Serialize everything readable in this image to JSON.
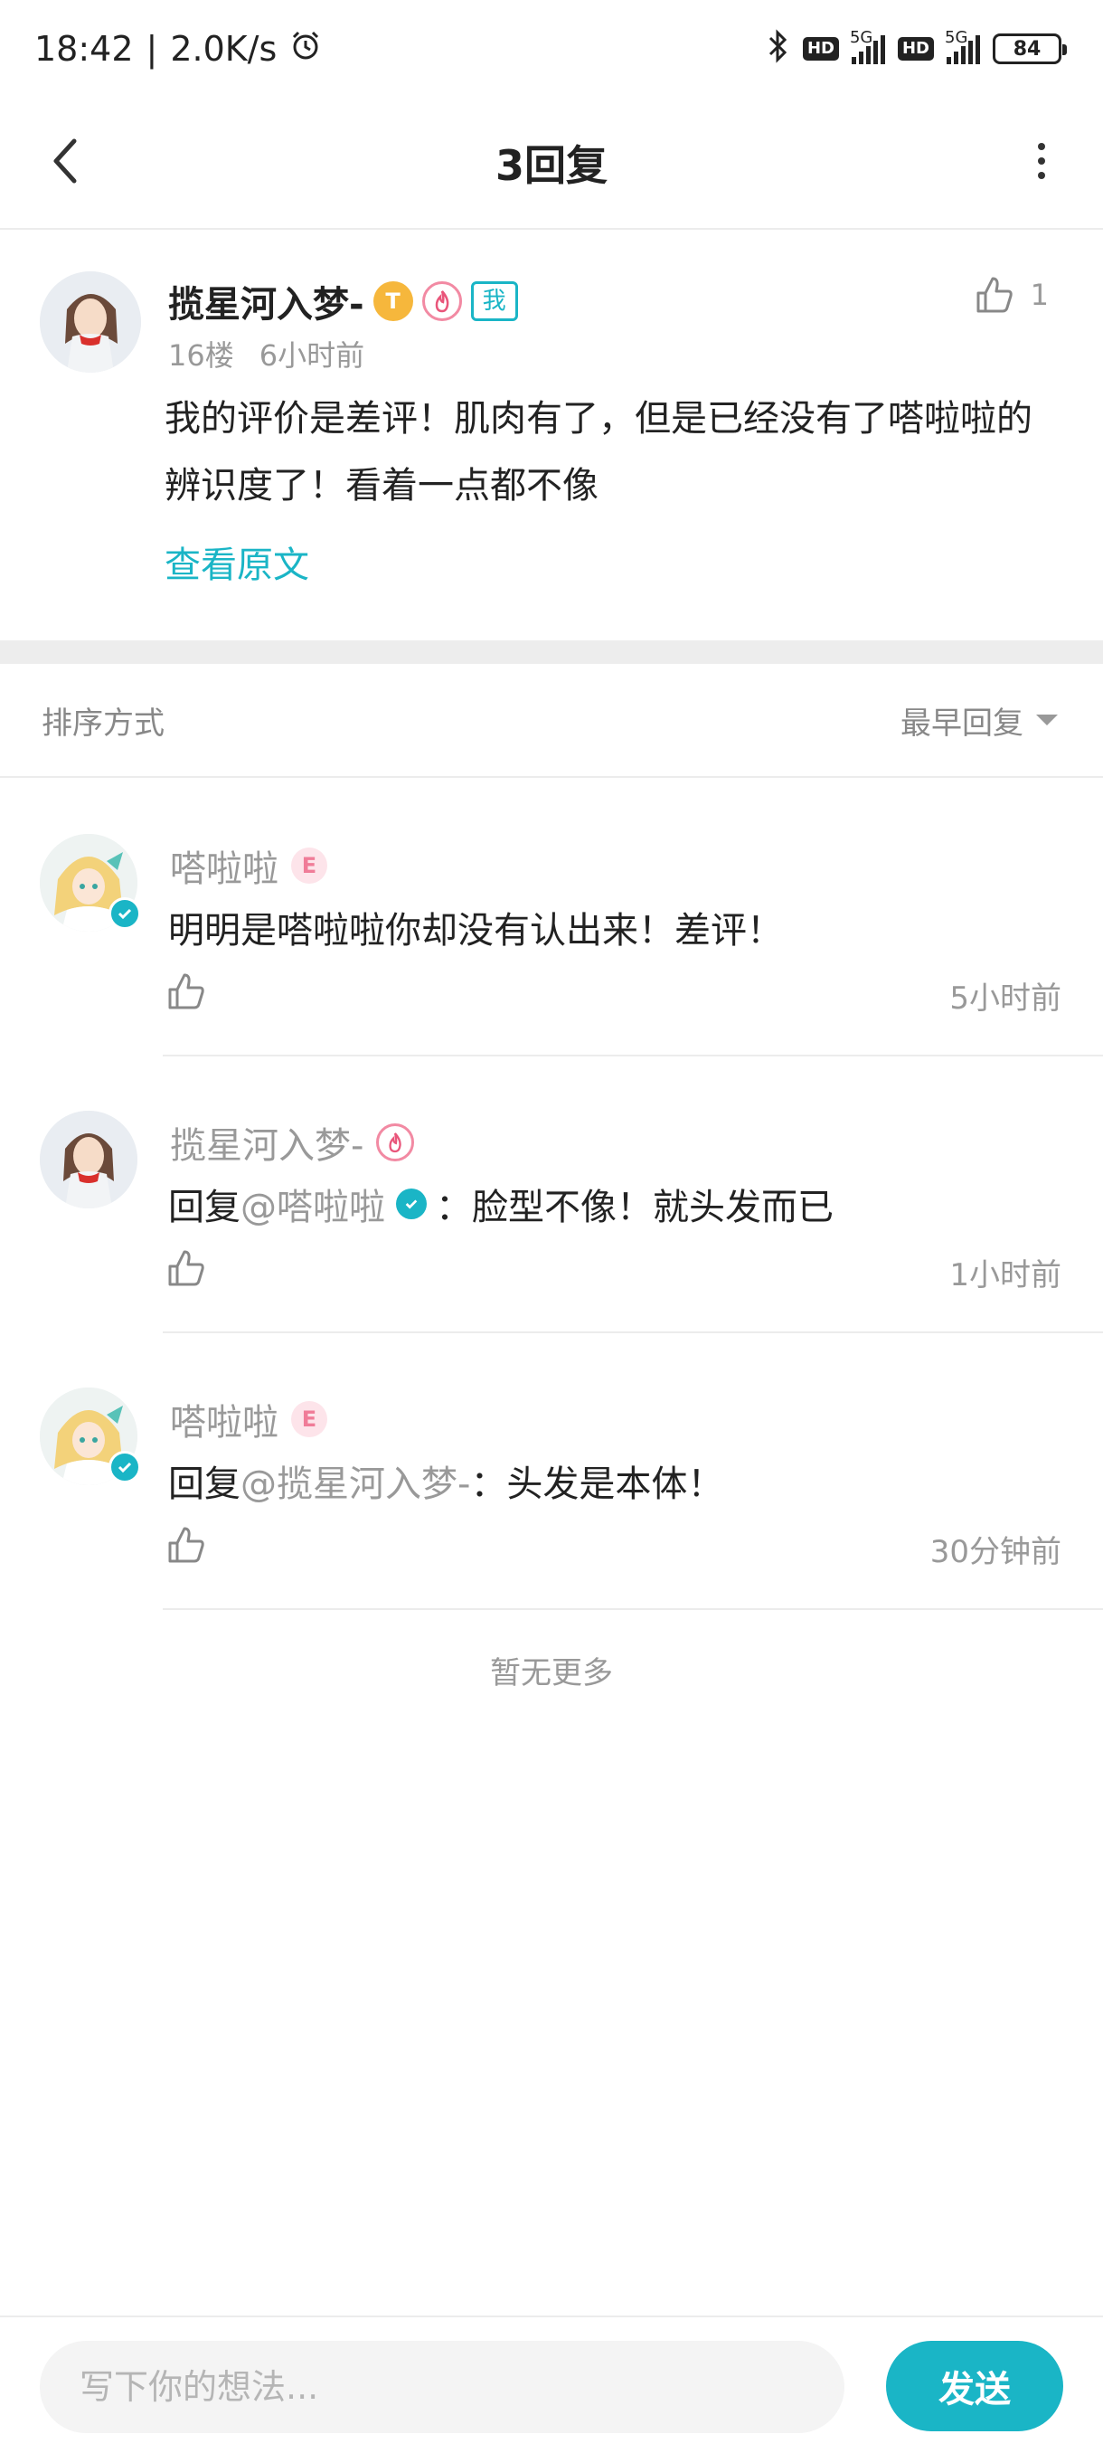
{
  "status_bar": {
    "time": "18:42",
    "speed": "2.0K/s",
    "network": "5G",
    "hd": "HD",
    "battery": "84"
  },
  "nav": {
    "title": "3回复"
  },
  "post": {
    "author": "揽星河入梦-",
    "level_letter": "T",
    "me_badge": "我",
    "likes": "1",
    "floor": "16楼",
    "time": "6小时前",
    "content": "我的评价是差评！肌肉有了，但是已经没有了嗒啦啦的辨识度了！看着一点都不像",
    "view_original": "查看原文"
  },
  "sort": {
    "label": "排序方式",
    "selected": "最早回复"
  },
  "replies": [
    {
      "author": "嗒啦啦",
      "badge": "E",
      "prefix": "",
      "mention": "",
      "text": "明明是嗒啦啦你却没有认出来！差评！",
      "time": "5小时前"
    },
    {
      "author": "揽星河入梦-",
      "badge": "fire",
      "prefix": "回复",
      "mention": "@嗒啦啦",
      "text": "：脸型不像！就头发而已",
      "time": "1小时前"
    },
    {
      "author": "嗒啦啦",
      "badge": "E",
      "prefix": "回复",
      "mention": "@揽星河入梦-",
      "text": "：头发是本体！",
      "time": "30分钟前"
    }
  ],
  "no_more": "暂无更多",
  "composer": {
    "placeholder": "写下你的想法...",
    "send_label": "发送"
  },
  "colors": {
    "accent": "#1ab5c6",
    "level_badge": "#f6b73c",
    "pink_badge": "#f07c98"
  }
}
